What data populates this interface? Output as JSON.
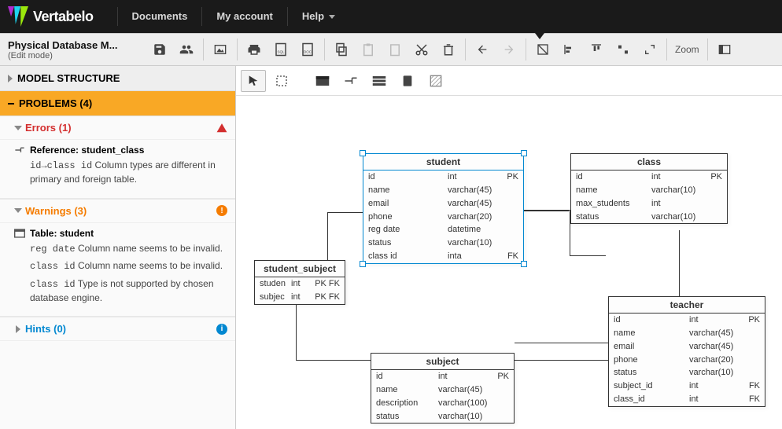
{
  "brand": "Vertabelo",
  "nav": {
    "documents": "Documents",
    "account": "My account",
    "help": "Help"
  },
  "toolbar": {
    "title": "Physical Database M...",
    "mode": "(Edit mode)",
    "zoom_label": "Zoom"
  },
  "sidebar": {
    "model_structure": "MODEL STRUCTURE",
    "problems_label": "PROBLEMS (4)",
    "errors_label": "Errors (1)",
    "warnings_label": "Warnings (3)",
    "hints_label": "Hints (0)",
    "error_ref_title": "Reference: student_class",
    "error_ref_code": "id→class id",
    "error_ref_msg": " Column types are different in primary and foreign table.",
    "warn_table_title": "Table: student",
    "warn1_code": "reg date",
    "warn1_msg": " Column name seems to be invalid.",
    "warn2_code": "class id",
    "warn2_msg": " Column name seems to be invalid.",
    "warn3_code": "class id",
    "warn3_msg": " Type is not supported by chosen database engine."
  },
  "entities": {
    "student": {
      "title": "student",
      "rows": [
        {
          "n": "id",
          "t": "int",
          "k": "PK"
        },
        {
          "n": "name",
          "t": "varchar(45)",
          "k": ""
        },
        {
          "n": "email",
          "t": "varchar(45)",
          "k": ""
        },
        {
          "n": "phone",
          "t": "varchar(20)",
          "k": ""
        },
        {
          "n": "reg date",
          "t": "datetime",
          "k": ""
        },
        {
          "n": "status",
          "t": "varchar(10)",
          "k": ""
        },
        {
          "n": "class id",
          "t": "inta",
          "k": "FK"
        }
      ]
    },
    "class": {
      "title": "class",
      "rows": [
        {
          "n": "id",
          "t": "int",
          "k": "PK"
        },
        {
          "n": "name",
          "t": "varchar(10)",
          "k": ""
        },
        {
          "n": "max_students",
          "t": "int",
          "k": ""
        },
        {
          "n": "status",
          "t": "varchar(10)",
          "k": ""
        }
      ]
    },
    "student_subject": {
      "title": "student_subject",
      "rows": [
        {
          "n": "studen",
          "t": "int",
          "k": "PK FK"
        },
        {
          "n": "subjec",
          "t": "int",
          "k": "PK FK"
        }
      ]
    },
    "subject": {
      "title": "subject",
      "rows": [
        {
          "n": "id",
          "t": "int",
          "k": "PK"
        },
        {
          "n": "name",
          "t": "varchar(45)",
          "k": ""
        },
        {
          "n": "description",
          "t": "varchar(100)",
          "k": ""
        },
        {
          "n": "status",
          "t": "varchar(10)",
          "k": ""
        }
      ]
    },
    "teacher": {
      "title": "teacher",
      "rows": [
        {
          "n": "id",
          "t": "int",
          "k": "PK"
        },
        {
          "n": "name",
          "t": "varchar(45)",
          "k": ""
        },
        {
          "n": "email",
          "t": "varchar(45)",
          "k": ""
        },
        {
          "n": "phone",
          "t": "varchar(20)",
          "k": ""
        },
        {
          "n": "status",
          "t": "varchar(10)",
          "k": ""
        },
        {
          "n": "subject_id",
          "t": "int",
          "k": "FK"
        },
        {
          "n": "class_id",
          "t": "int",
          "k": "FK"
        }
      ]
    }
  }
}
